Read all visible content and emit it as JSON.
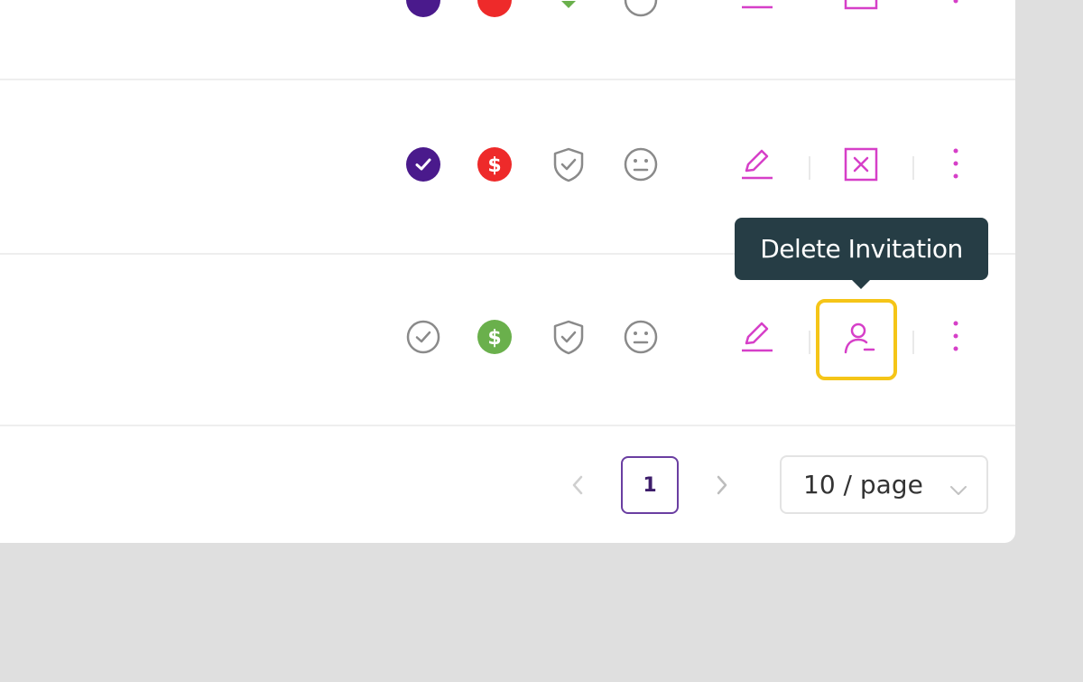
{
  "tooltip": {
    "text": "Delete Invitation"
  },
  "pagination": {
    "current_page": "1",
    "page_size_label": "10 / page",
    "prev_icon": "chevron-left-icon",
    "next_icon": "chevron-right-icon"
  },
  "rows": [
    {
      "status_icons": [
        "verified-check-icon",
        "payment-dollar-icon",
        "shield-check-icon",
        "neutral-face-icon"
      ],
      "actions": [
        "edit-icon",
        "delete-square-icon",
        "more-vertical-icon"
      ]
    },
    {
      "status_icons": [
        "verified-check-icon",
        "payment-dollar-icon",
        "shield-check-icon",
        "neutral-face-icon"
      ],
      "actions": [
        "edit-icon",
        "delete-square-icon",
        "more-vertical-icon"
      ]
    },
    {
      "status_icons": [
        "unverified-check-icon",
        "payment-dollar-icon",
        "shield-check-icon",
        "neutral-face-icon"
      ],
      "actions": [
        "edit-icon",
        "delete-invitation-icon",
        "more-vertical-icon"
      ]
    }
  ],
  "colors": {
    "accent": "#d63fc8",
    "verified": "#4a1a8c",
    "unpaid": "#ee2a2a",
    "paid": "#6ab04c",
    "neutral": "#8a8a8a",
    "tooltip_bg": "#263d45",
    "highlight": "#f5c518",
    "page_border": "#6a3ea1"
  }
}
